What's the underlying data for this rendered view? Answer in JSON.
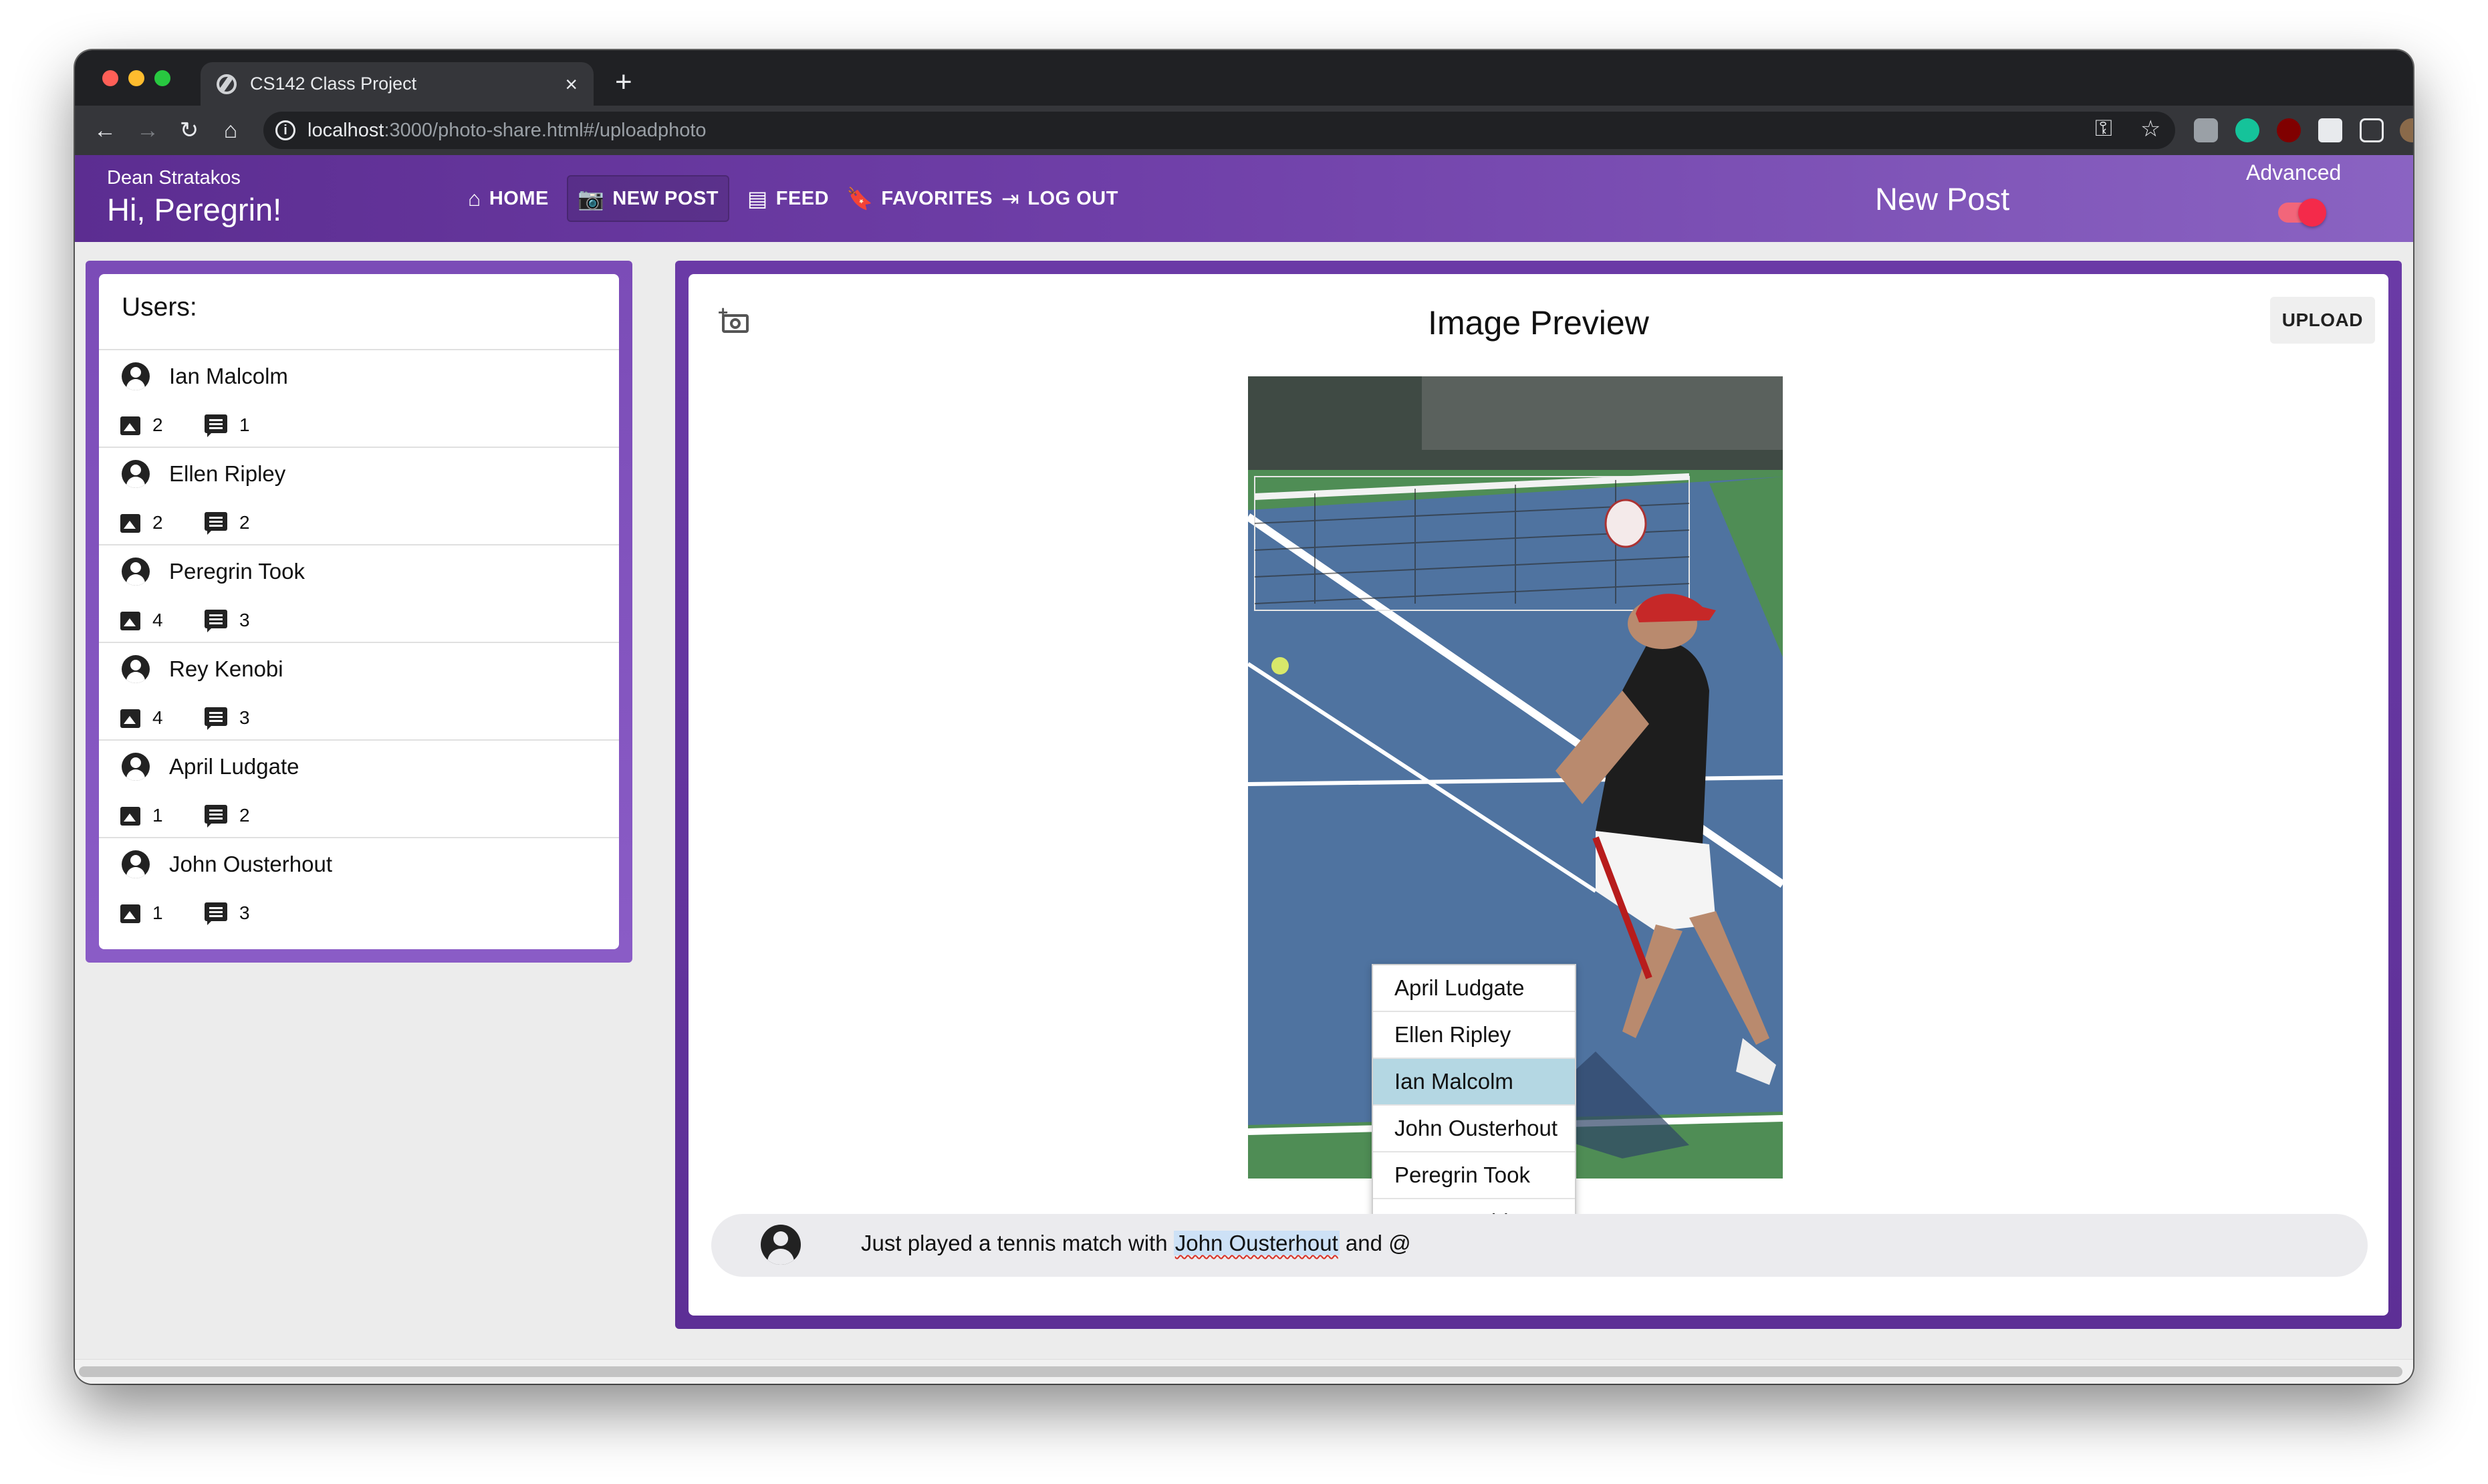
{
  "browser": {
    "tab_title": "CS142 Class Project",
    "tab_close": "×",
    "new_tab": "+",
    "url_host": "localhost",
    "url_rest": ":3000/photo-share.html#/uploadphoto",
    "back_glyph": "←",
    "forward_glyph": "→",
    "reload_glyph": "↻",
    "home_glyph": "⌂",
    "key_glyph": "⚿",
    "star_glyph": "☆",
    "menu_glyph": "⋮"
  },
  "appbar": {
    "user_name": "Dean Stratakos",
    "greeting": "Hi, Peregrin!",
    "nav": [
      {
        "label": "HOME",
        "icon": "home-icon",
        "glyph": "⌂"
      },
      {
        "label": "NEW POST",
        "icon": "camera-icon",
        "glyph": "📷"
      },
      {
        "label": "FEED",
        "icon": "feed-icon",
        "glyph": "▤"
      },
      {
        "label": "FAVORITES",
        "icon": "bookmark-icon",
        "glyph": "🔖"
      },
      {
        "label": "LOG OUT",
        "icon": "logout-icon",
        "glyph": "⇥"
      }
    ],
    "page_title": "New Post",
    "advanced_label": "Advanced",
    "advanced_on": true,
    "colors": {
      "bar_start": "#5c2d91",
      "bar_end": "#8a63c2",
      "toggle": "#f42a4a"
    }
  },
  "users_panel": {
    "title": "Users:",
    "users": [
      {
        "name": "Ian Malcolm",
        "photos": "2",
        "comments": "1"
      },
      {
        "name": "Ellen Ripley",
        "photos": "2",
        "comments": "2"
      },
      {
        "name": "Peregrin Took",
        "photos": "4",
        "comments": "3"
      },
      {
        "name": "Rey Kenobi",
        "photos": "4",
        "comments": "3"
      },
      {
        "name": "April Ludgate",
        "photos": "1",
        "comments": "2"
      },
      {
        "name": "John Ousterhout",
        "photos": "1",
        "comments": "3"
      }
    ]
  },
  "main": {
    "preview_title": "Image Preview",
    "upload_label": "UPLOAD",
    "mention_options": [
      {
        "name": "April Ludgate",
        "selected": false
      },
      {
        "name": "Ellen Ripley",
        "selected": false
      },
      {
        "name": "Ian Malcolm",
        "selected": true
      },
      {
        "name": "John Ousterhout",
        "selected": false
      },
      {
        "name": "Peregrin Took",
        "selected": false
      },
      {
        "name": "Rey Kenobi",
        "selected": false
      }
    ],
    "caption": {
      "before": "Just played a tennis match with ",
      "mention": "John Ousterhout",
      "after": " and @"
    }
  }
}
